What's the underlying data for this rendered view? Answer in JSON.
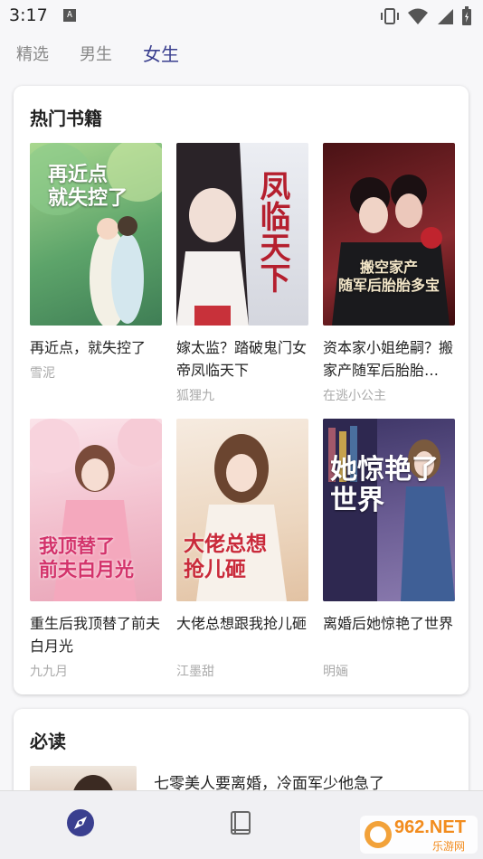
{
  "status_bar": {
    "time": "3:17",
    "notification_icon_letter": "A",
    "icons": [
      "vibrate-icon",
      "wifi-icon",
      "signal-icon",
      "battery-icon"
    ]
  },
  "tabs": [
    {
      "label": "精选"
    },
    {
      "label": "男生"
    },
    {
      "label": "女生",
      "active": true
    }
  ],
  "hot_books": {
    "title": "热门书籍",
    "books": [
      {
        "title": "再近点，就失控了",
        "author": "雪泥",
        "cover_text": "再近点\n就失控了",
        "cover_color": "#6fb47a"
      },
      {
        "title": "嫁太监？踏破鬼门女帝凤临天下",
        "author": "狐狸九",
        "cover_text": "凤临天下",
        "cover_color": "#d9dbe3"
      },
      {
        "title": "资本家小姐绝嗣？搬家产随军后胎胎…",
        "author": "在逃小公主",
        "cover_text": "搬空家产\n随军后胎胎多宝",
        "cover_color": "#7a1f25"
      },
      {
        "title": "重生后我顶替了前夫白月光",
        "author": "九九月",
        "cover_text": "我顶替了\n前夫白月光",
        "cover_color": "#f3c9d3"
      },
      {
        "title": "大佬总想跟我抢儿砸",
        "author": "江墨甜",
        "cover_text": "大佬总想\n抢儿砸",
        "cover_color": "#f1e2d2"
      },
      {
        "title": "离婚后她惊艳了世界",
        "author": "明婳",
        "cover_text": "她惊艳了\n世界",
        "cover_color": "#5b4e8a"
      }
    ]
  },
  "must_read": {
    "title": "必读",
    "first_item": {
      "title": "七零美人要离婚，冷面军少他急了"
    }
  },
  "bottom_nav": [
    {
      "icon": "compass-icon",
      "active": true
    },
    {
      "icon": "book-icon"
    }
  ],
  "watermark": {
    "text": "962.NET",
    "subtext": "乐游网"
  },
  "colors": {
    "accent": "#3a3f8f"
  }
}
